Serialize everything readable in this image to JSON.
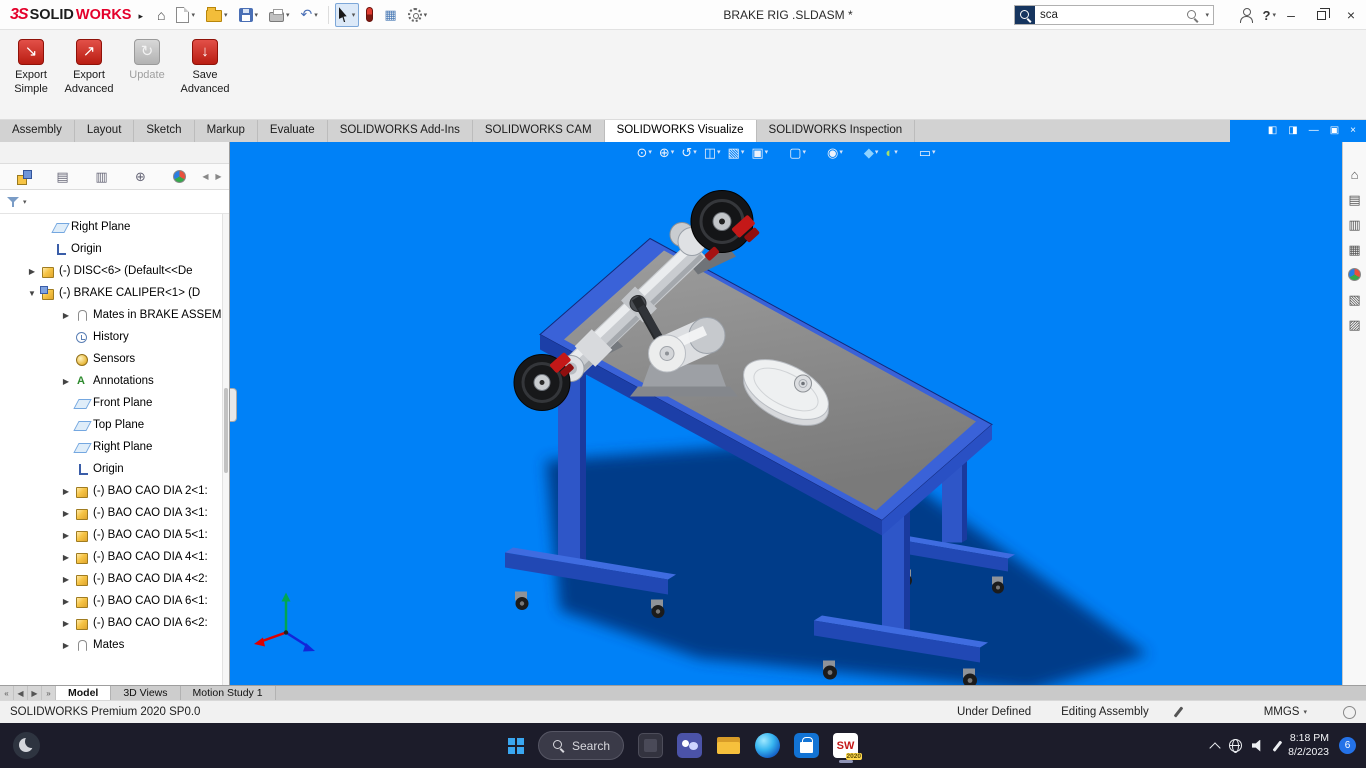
{
  "colors": {
    "viewport_bg": "#0081f7",
    "table_blue": "#3a62d8",
    "table_front": "#2148b4",
    "shadow": "#00357e",
    "accent_red": "#e4002b",
    "taskbar_bg": "#1c1c2a"
  },
  "icons": {
    "caret": "▾",
    "home": "⌂",
    "undo": "↶",
    "grid": "▦",
    "flyout": "▸",
    "min": "–",
    "close": "×"
  },
  "titlebar": {
    "logo_3ds": "3S",
    "logo_solid": "SOLID",
    "logo_works": "WORKS",
    "title": "BRAKE RIG .SLDASM *",
    "search_value": "sca",
    "help_label": "?"
  },
  "ribbon": {
    "buttons": [
      {
        "line1": "Export",
        "line2": "Simple",
        "glyph": "↘",
        "iconCls": "ic-red",
        "cls": ""
      },
      {
        "line1": "Export",
        "line2": "Advanced",
        "glyph": "↗",
        "iconCls": "ic-red",
        "cls": ""
      },
      {
        "line1": "Update",
        "line2": "",
        "glyph": "↻",
        "iconCls": "ic-gray",
        "cls": "disabled"
      },
      {
        "line1": "Save",
        "line2": "Advanced",
        "glyph": "↓",
        "iconCls": "ic-red",
        "cls": ""
      }
    ]
  },
  "tabs": {
    "items": [
      {
        "label": "Assembly",
        "cls": ""
      },
      {
        "label": "Layout",
        "cls": ""
      },
      {
        "label": "Sketch",
        "cls": ""
      },
      {
        "label": "Markup",
        "cls": ""
      },
      {
        "label": "Evaluate",
        "cls": ""
      },
      {
        "label": "SOLIDWORKS Add-Ins",
        "cls": ""
      },
      {
        "label": "SOLIDWORKS CAM",
        "cls": ""
      },
      {
        "label": "SOLIDWORKS Visualize",
        "cls": "active"
      },
      {
        "label": "SOLIDWORKS Inspection",
        "cls": ""
      }
    ],
    "window_icons": [
      {
        "glyph": "◧"
      },
      {
        "glyph": "◨"
      },
      {
        "glyph": "—"
      },
      {
        "glyph": "▣"
      },
      {
        "glyph": "×"
      }
    ]
  },
  "panel": {
    "nav_left": "◀",
    "nav_right": "▶",
    "tab_glyphs": {
      "property": "▤",
      "configuration": "▥",
      "dimxpert": "⊕"
    },
    "tree": {
      "items": [
        {
          "lvl": "lvl1",
          "arrow": "",
          "icon": "ico-plane",
          "label": "Right Plane"
        },
        {
          "lvl": "lvl1",
          "arrow": "",
          "icon": "ico-origin",
          "label": "Origin"
        },
        {
          "lvl": "lvl0",
          "arrow": "▶",
          "icon": "ico-part",
          "label": "(-) DISC<6> (Default<<De"
        },
        {
          "lvl": "lvl0",
          "arrow": "▼",
          "icon": "ico-assembly",
          "label": "(-) BRAKE CALIPER<1> (D"
        },
        {
          "lvl": "lvl2",
          "arrow": "▶",
          "icon": "ico-mates",
          "label": "Mates in BRAKE ASSEM"
        },
        {
          "lvl": "lvl2",
          "arrow": "",
          "icon": "ico-history",
          "label": "History"
        },
        {
          "lvl": "lvl2",
          "arrow": "",
          "icon": "ico-sensors",
          "label": "Sensors"
        },
        {
          "lvl": "lvl2",
          "arrow": "▶",
          "icon": "ico-annotations",
          "label": "Annotations"
        },
        {
          "lvl": "lvl2",
          "arrow": "",
          "icon": "ico-plane",
          "label": "Front Plane"
        },
        {
          "lvl": "lvl2",
          "arrow": "",
          "icon": "ico-plane",
          "label": "Top Plane"
        },
        {
          "lvl": "lvl2",
          "arrow": "",
          "icon": "ico-plane",
          "label": "Right Plane"
        },
        {
          "lvl": "lvl2",
          "arrow": "",
          "icon": "ico-origin",
          "label": "Origin"
        },
        {
          "lvl": "lvl2",
          "arrow": "▶",
          "icon": "ico-part",
          "label": "(-) BAO CAO DIA 2<1:"
        },
        {
          "lvl": "lvl2",
          "arrow": "▶",
          "icon": "ico-part",
          "label": "(-) BAO CAO DIA 3<1:"
        },
        {
          "lvl": "lvl2",
          "arrow": "▶",
          "icon": "ico-part",
          "label": "(-) BAO CAO DIA 5<1:"
        },
        {
          "lvl": "lvl2",
          "arrow": "▶",
          "icon": "ico-part",
          "label": "(-) BAO CAO DIA 4<1:"
        },
        {
          "lvl": "lvl2",
          "arrow": "▶",
          "icon": "ico-part",
          "label": "(-) BAO CAO DIA 4<2:"
        },
        {
          "lvl": "lvl2",
          "arrow": "▶",
          "icon": "ico-part",
          "label": "(-) BAO CAO DIA 6<1:"
        },
        {
          "lvl": "lvl2",
          "arrow": "▶",
          "icon": "ico-part",
          "label": "(-) BAO CAO DIA 6<2:"
        },
        {
          "lvl": "lvl2",
          "arrow": "▶",
          "icon": "ico-mates",
          "label": "Mates"
        }
      ]
    }
  },
  "viewport_toolbar": {
    "items": [
      {
        "name": "zoom-to-fit",
        "glyph": "⊙",
        "gap": ""
      },
      {
        "name": "zoom-to-area",
        "glyph": "⊕",
        "gap": ""
      },
      {
        "name": "previous-view",
        "glyph": "↺",
        "gap": ""
      },
      {
        "name": "section-view",
        "glyph": "◫",
        "gap": ""
      },
      {
        "name": "annotation-visibility",
        "glyph": "▧",
        "gap": ""
      },
      {
        "name": "view-orientation",
        "glyph": "▣",
        "gap": ""
      },
      {
        "name": "copy-settings",
        "glyph": "▢",
        "gap": "gap"
      },
      {
        "name": "display-style",
        "glyph": "◉",
        "gap": "gap"
      },
      {
        "name": "edit-appearance",
        "glyph": "◆",
        "gap": "gap",
        "color": "#8fd3ff"
      },
      {
        "name": "apply-scene",
        "glyph": "◐",
        "gap": "",
        "color": "#a6e06a"
      },
      {
        "name": "view-settings",
        "glyph": "▭",
        "gap": "gap"
      }
    ]
  },
  "task_pane": {
    "items": [
      {
        "glyph": "⌂",
        "cls": "tp-ic"
      },
      {
        "glyph": "▤",
        "cls": "tp-ic"
      },
      {
        "glyph": "▥",
        "cls": "tp-ic"
      },
      {
        "glyph": "▦",
        "cls": "tp-ic"
      },
      {
        "glyph": "",
        "cls": "tp-ball"
      },
      {
        "glyph": "▧",
        "cls": "tp-ic"
      },
      {
        "glyph": "▨",
        "cls": "tp-ic"
      }
    ]
  },
  "bottom_tabs": {
    "nav": [
      {
        "glyph": "«"
      },
      {
        "glyph": "◀"
      },
      {
        "glyph": "▶"
      },
      {
        "glyph": "»"
      }
    ],
    "items": [
      {
        "label": "Model",
        "cls": "active"
      },
      {
        "label": "3D Views",
        "cls": ""
      },
      {
        "label": "Motion Study 1",
        "cls": ""
      }
    ]
  },
  "statusbar": {
    "left": "SOLIDWORKS Premium 2020 SP0.0",
    "define_status": "Under Defined",
    "edit_status": "Editing Assembly",
    "units": "MMGS"
  },
  "taskbar": {
    "search_label": "Search",
    "sw_label": "SW",
    "sw_badge": "2020",
    "time": "8:18 PM",
    "date": "8/2/2023",
    "badge_count": "6"
  }
}
